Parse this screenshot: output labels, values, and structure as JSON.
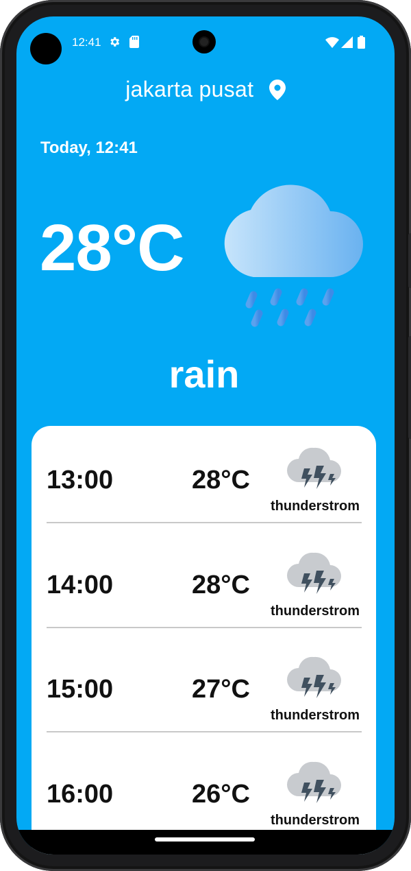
{
  "status_bar": {
    "time": "12:41",
    "icons": [
      "gear-icon",
      "sd-card-icon",
      "wifi-icon",
      "signal-icon",
      "battery-icon"
    ]
  },
  "location": {
    "name": "jakarta pusat",
    "icon": "location-pin-icon"
  },
  "current": {
    "date_time": "Today, 12:41",
    "temperature": "28°C",
    "condition": "rain",
    "icon": "rain-cloud-icon"
  },
  "forecast": [
    {
      "time": "13:00",
      "temp": "28°C",
      "desc": "thunderstrom",
      "icon": "thunderstorm-icon"
    },
    {
      "time": "14:00",
      "temp": "28°C",
      "desc": "thunderstrom",
      "icon": "thunderstorm-icon"
    },
    {
      "time": "15:00",
      "temp": "27°C",
      "desc": "thunderstrom",
      "icon": "thunderstorm-icon"
    },
    {
      "time": "16:00",
      "temp": "26°C",
      "desc": "thunderstrom",
      "icon": "thunderstorm-icon"
    }
  ],
  "colors": {
    "background": "#03A9F4",
    "card": "#FFFFFF",
    "text_on_blue": "#FFFFFF",
    "text_on_card": "#111111",
    "divider": "#C8C8C8"
  }
}
